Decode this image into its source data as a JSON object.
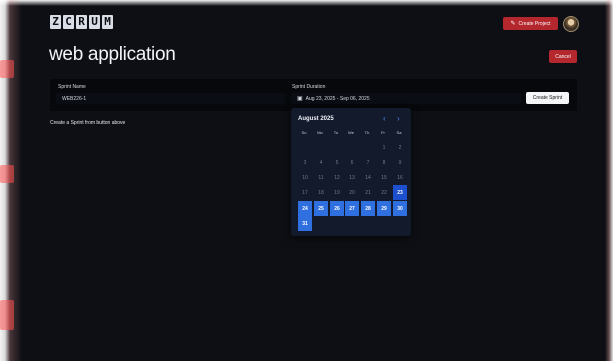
{
  "logo": {
    "letters": [
      "Z",
      "C",
      "R",
      "U",
      "M"
    ]
  },
  "header": {
    "create_project_label": "Create Project",
    "create_project_icon": "edit-icon",
    "accent_color": "#b3272d"
  },
  "page": {
    "title": "web application",
    "cancel_label": "Cancel"
  },
  "form": {
    "sprint_name_label": "Sprint Name",
    "sprint_name_value": "WEB226-1",
    "sprint_duration_label": "Sprint Duration",
    "sprint_duration_value": "Aug 23, 2025 - Sep 06, 2025",
    "create_sprint_label": "Create Sprint"
  },
  "hint": "Create a Sprint from button above",
  "calendar": {
    "month_label": "August 2025",
    "weekdays": [
      "Su",
      "Mo",
      "Tu",
      "We",
      "Th",
      "Fr",
      "Sa"
    ],
    "weeks": [
      [
        "",
        "",
        "",
        "",
        "",
        "1",
        "2"
      ],
      [
        "3",
        "4",
        "5",
        "6",
        "7",
        "8",
        "9"
      ],
      [
        "10",
        "11",
        "12",
        "13",
        "14",
        "15",
        "16"
      ],
      [
        "17",
        "18",
        "19",
        "20",
        "21",
        "22",
        "23"
      ],
      [
        "24",
        "25",
        "26",
        "27",
        "28",
        "29",
        "30"
      ],
      [
        "31",
        "",
        "",
        "",
        "",
        "",
        ""
      ]
    ],
    "selected_start": "23",
    "selected_days": [
      "23",
      "24",
      "25",
      "26",
      "27",
      "28",
      "29",
      "30",
      "31"
    ],
    "selection_color": "#2f6fe0"
  }
}
